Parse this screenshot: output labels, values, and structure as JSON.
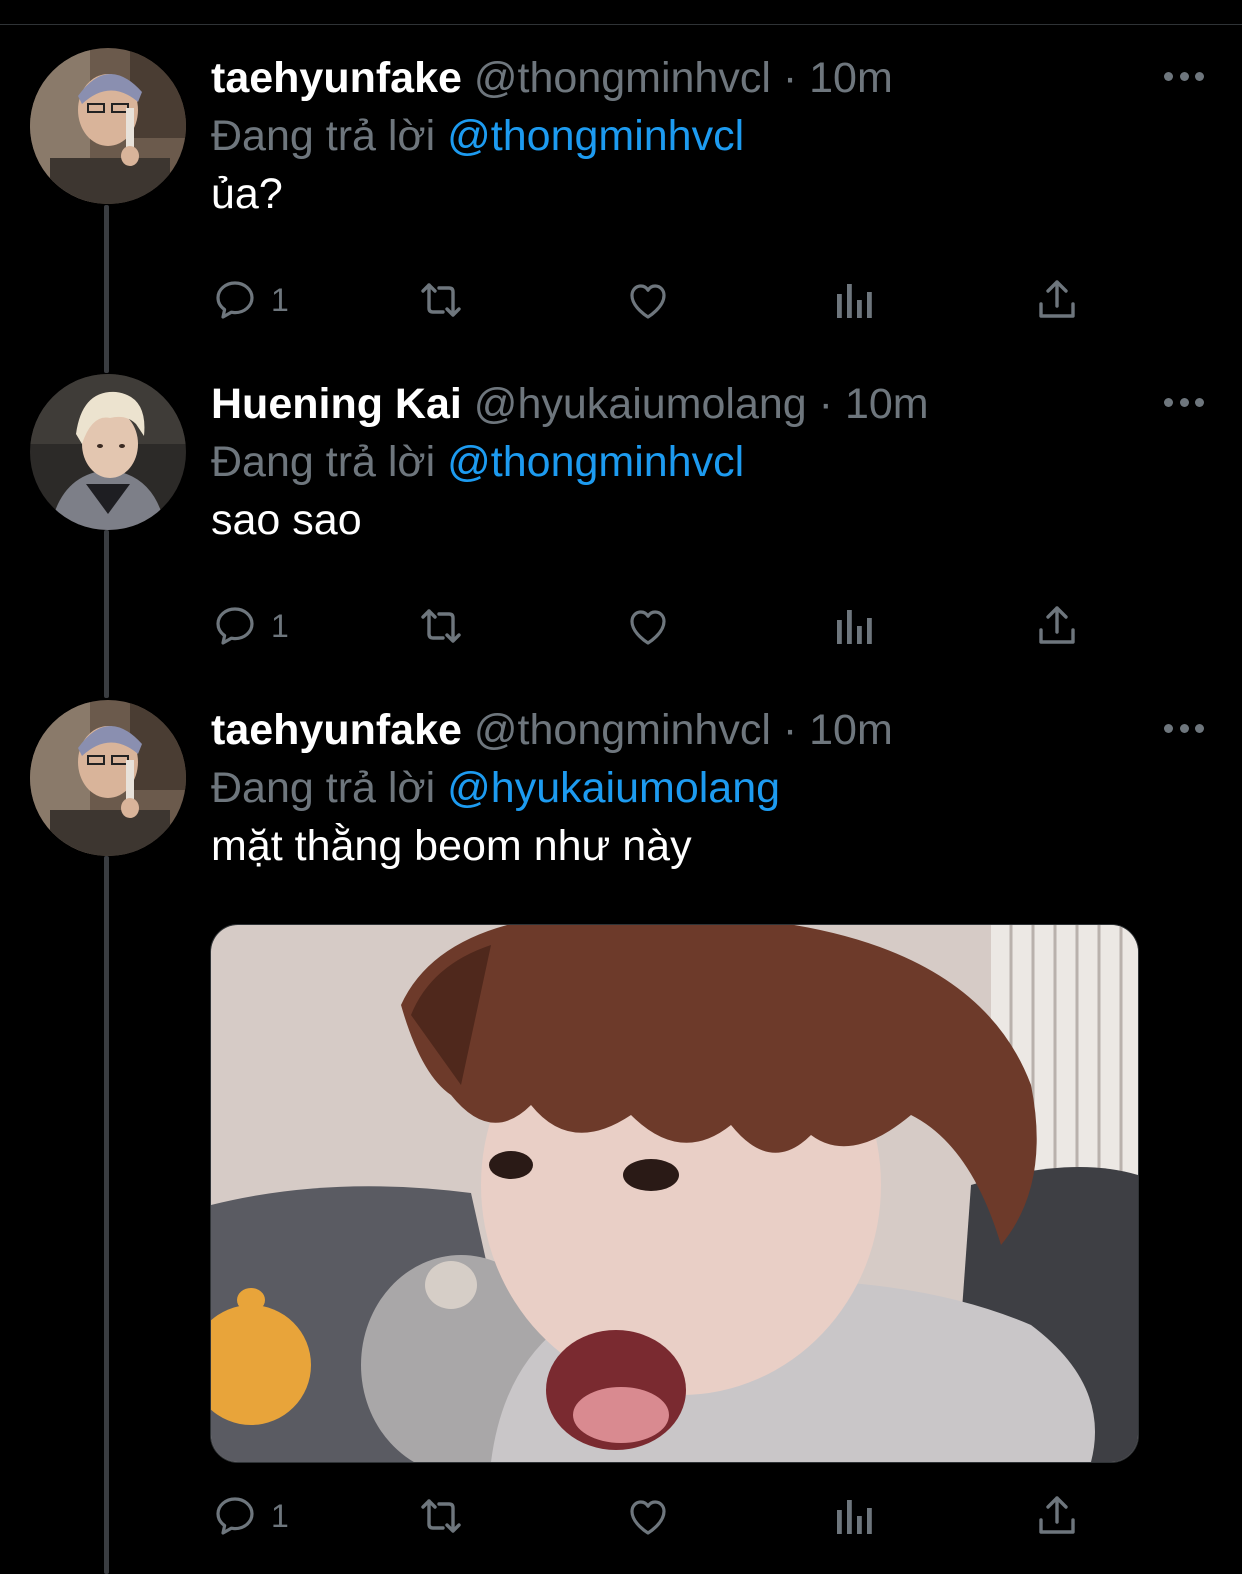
{
  "colors": {
    "background": "#000000",
    "text_primary": "#ffffff",
    "text_secondary": "#6e767d",
    "link": "#1d9bf0",
    "thread_line": "#3a3d41"
  },
  "tweets": [
    {
      "display_name": "taehyunfake",
      "handle": "@thongminhvcl",
      "separator": "·",
      "time": "10m",
      "reply_prefix": "Đang trả lời",
      "reply_to": "@thongminhvcl",
      "text": "ủa?",
      "reply_count": "1",
      "has_media": false
    },
    {
      "display_name": "Huening Kai",
      "handle": "@hyukaiumolang",
      "separator": "·",
      "time": "10m",
      "reply_prefix": "Đang trả lời",
      "reply_to": "@thongminhvcl",
      "text": "sao sao",
      "reply_count": "1",
      "has_media": false
    },
    {
      "display_name": "taehyunfake",
      "handle": "@thongminhvcl",
      "separator": "·",
      "time": "10m",
      "reply_prefix": "Đang trả lời",
      "reply_to": "@hyukaiumolang",
      "text": "mặt thằng beom như này",
      "reply_count": "1",
      "has_media": true
    }
  ],
  "icons": {
    "more": "more-horizontal-icon",
    "reply": "reply-bubble-icon",
    "retweet": "retweet-icon",
    "like": "heart-icon",
    "analytics": "analytics-bars-icon",
    "share": "share-upload-icon"
  }
}
